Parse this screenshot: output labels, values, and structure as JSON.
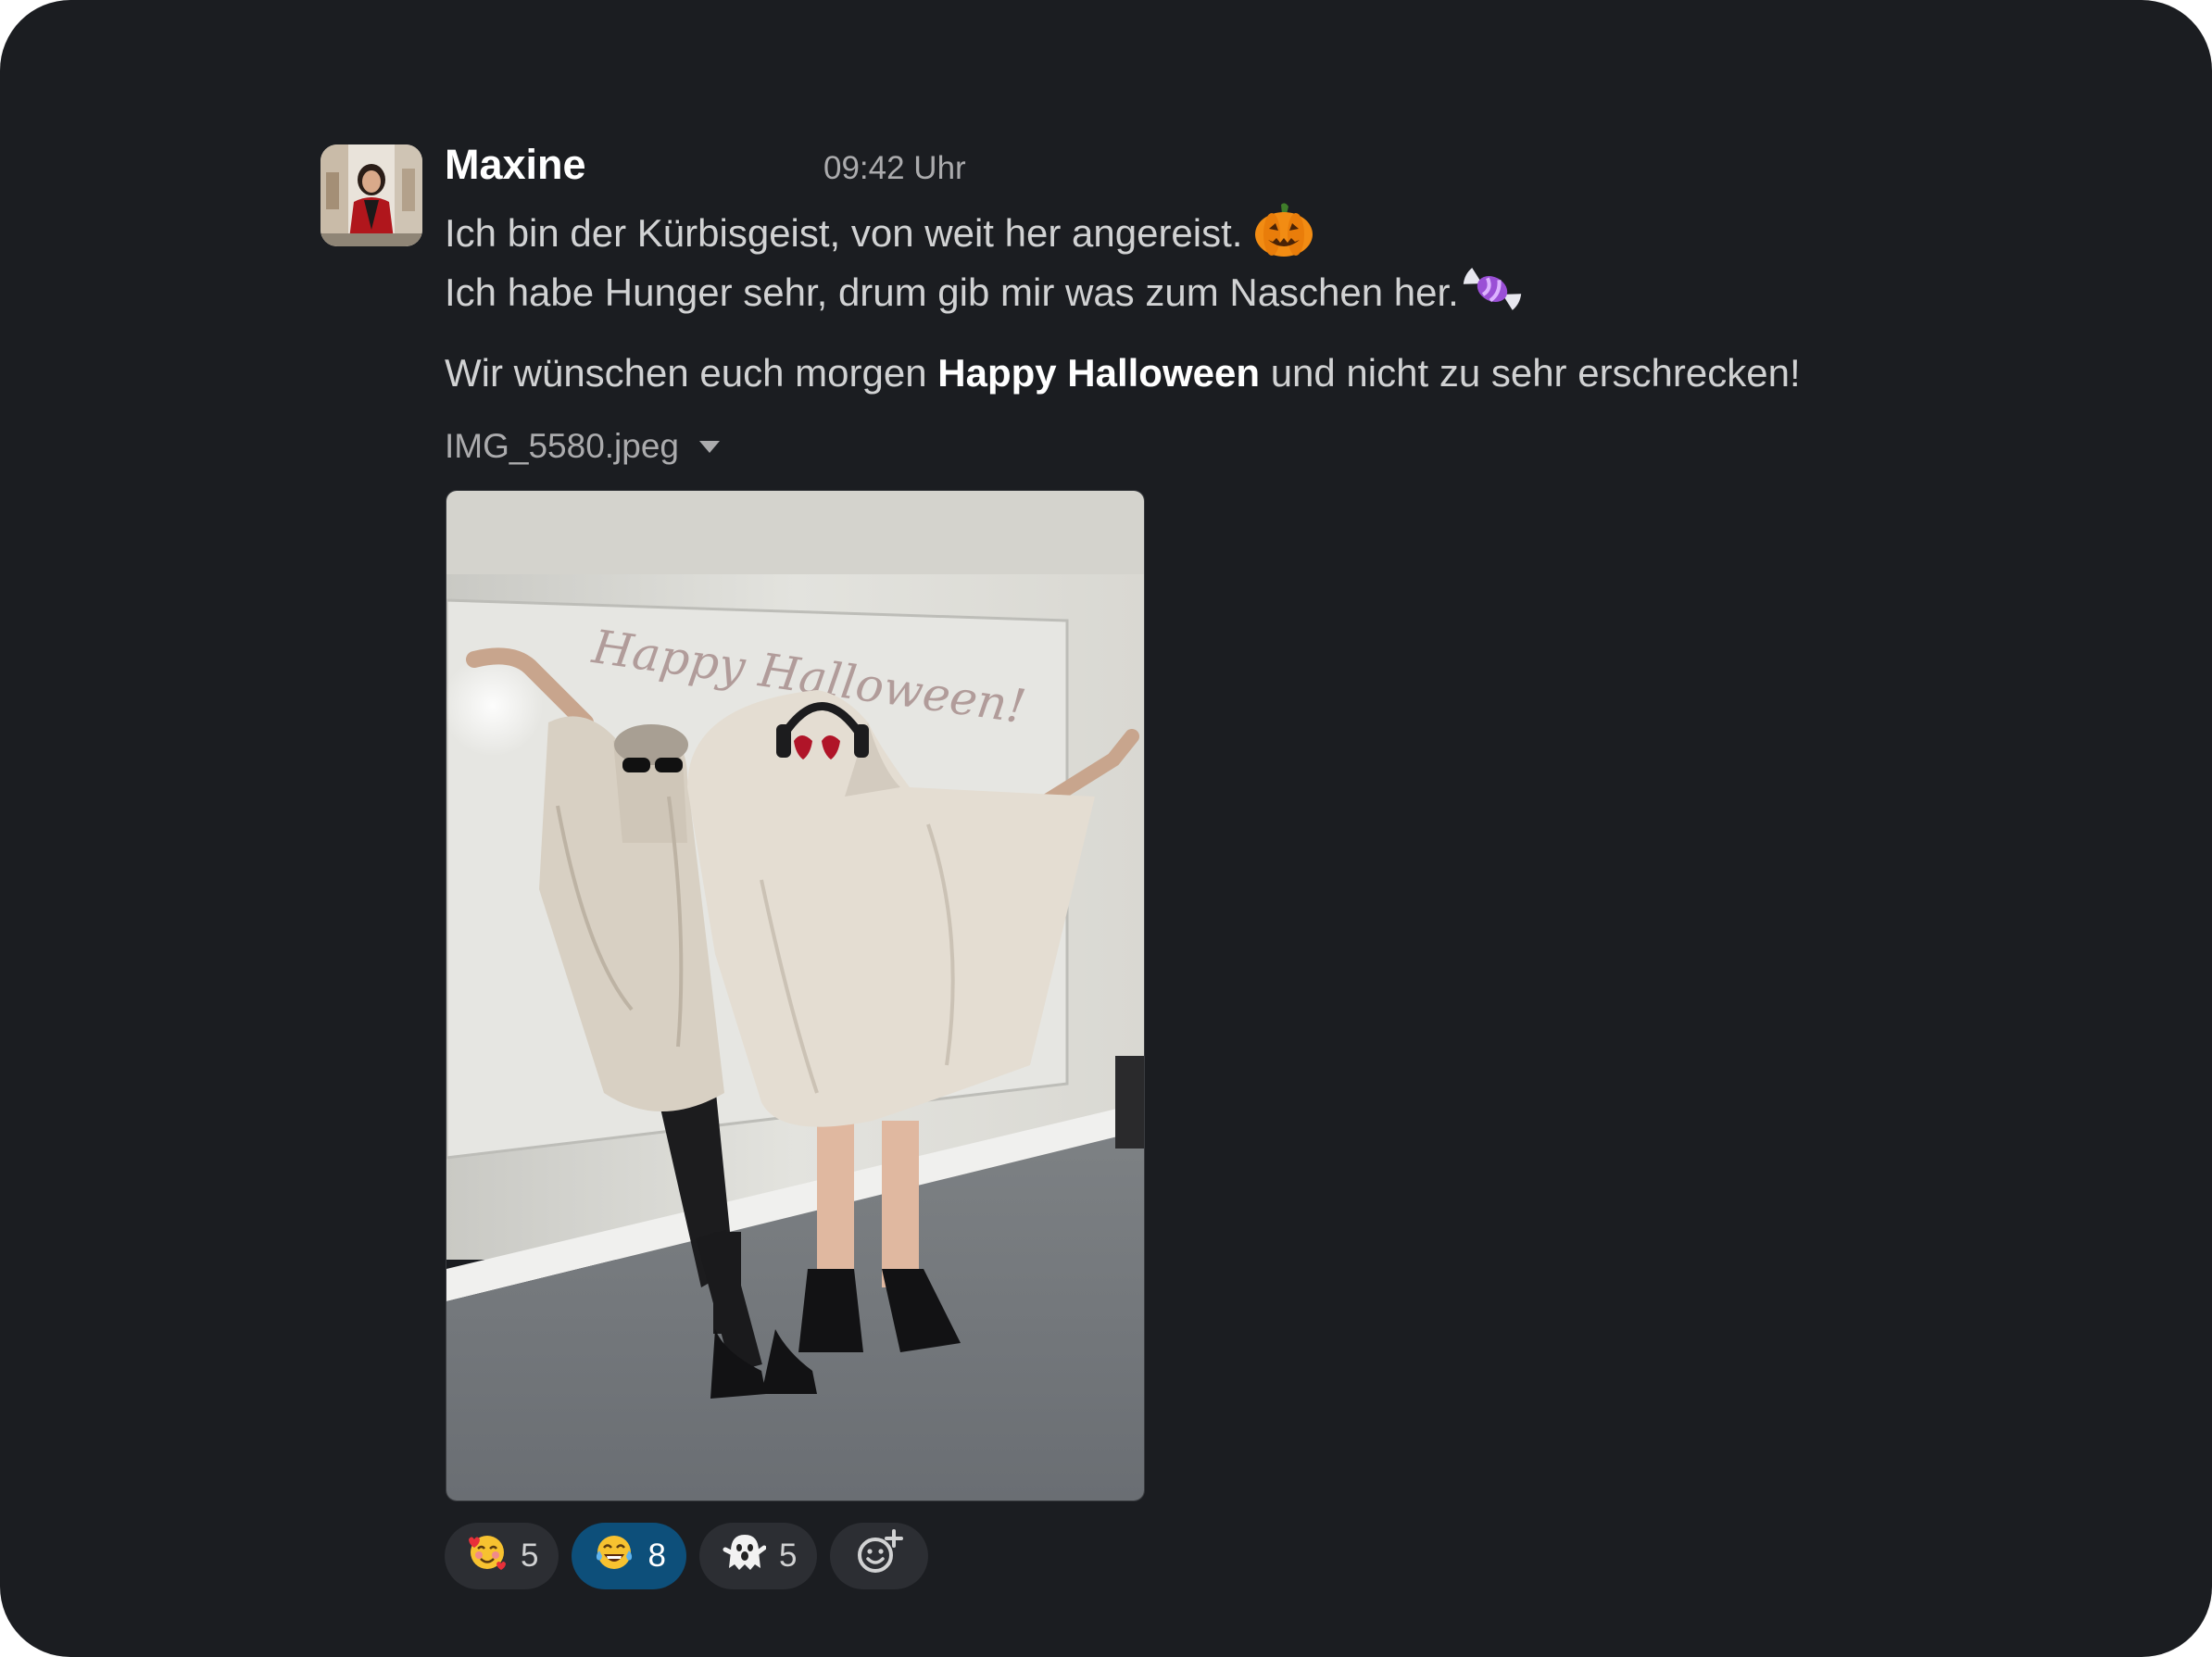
{
  "message": {
    "author": "Maxine",
    "time": "09:42 Uhr",
    "line1": "Ich bin der Kürbisgeist, von weit her angereist.",
    "line2": "Ich habe Hunger sehr, drum gib mir was zum Naschen her.",
    "line3_before": "Wir wünschen euch morgen",
    "line3_bold": "Happy Halloween",
    "line3_after": "und nicht zu sehr erschrecken!",
    "emoji_line1": "pumpkin-icon",
    "emoji_line2": "candy-icon"
  },
  "attachment": {
    "filename": "IMG_5580.jpeg",
    "photo_writing": "Happy Halloween!"
  },
  "reactions": [
    {
      "emoji": "smiling-face-with-hearts-icon",
      "count": "5",
      "active": false
    },
    {
      "emoji": "joy-face-icon",
      "count": "8",
      "active": true
    },
    {
      "emoji": "ghost-icon",
      "count": "5",
      "active": false
    },
    {
      "emoji": "add-reaction-icon",
      "count": "",
      "active": false
    }
  ],
  "colors": {
    "background": "#1b1d21",
    "active_reaction": "#0d4f7a",
    "reaction": "#2c2e33",
    "text": "#d1d2d3",
    "muted": "#ababad"
  }
}
